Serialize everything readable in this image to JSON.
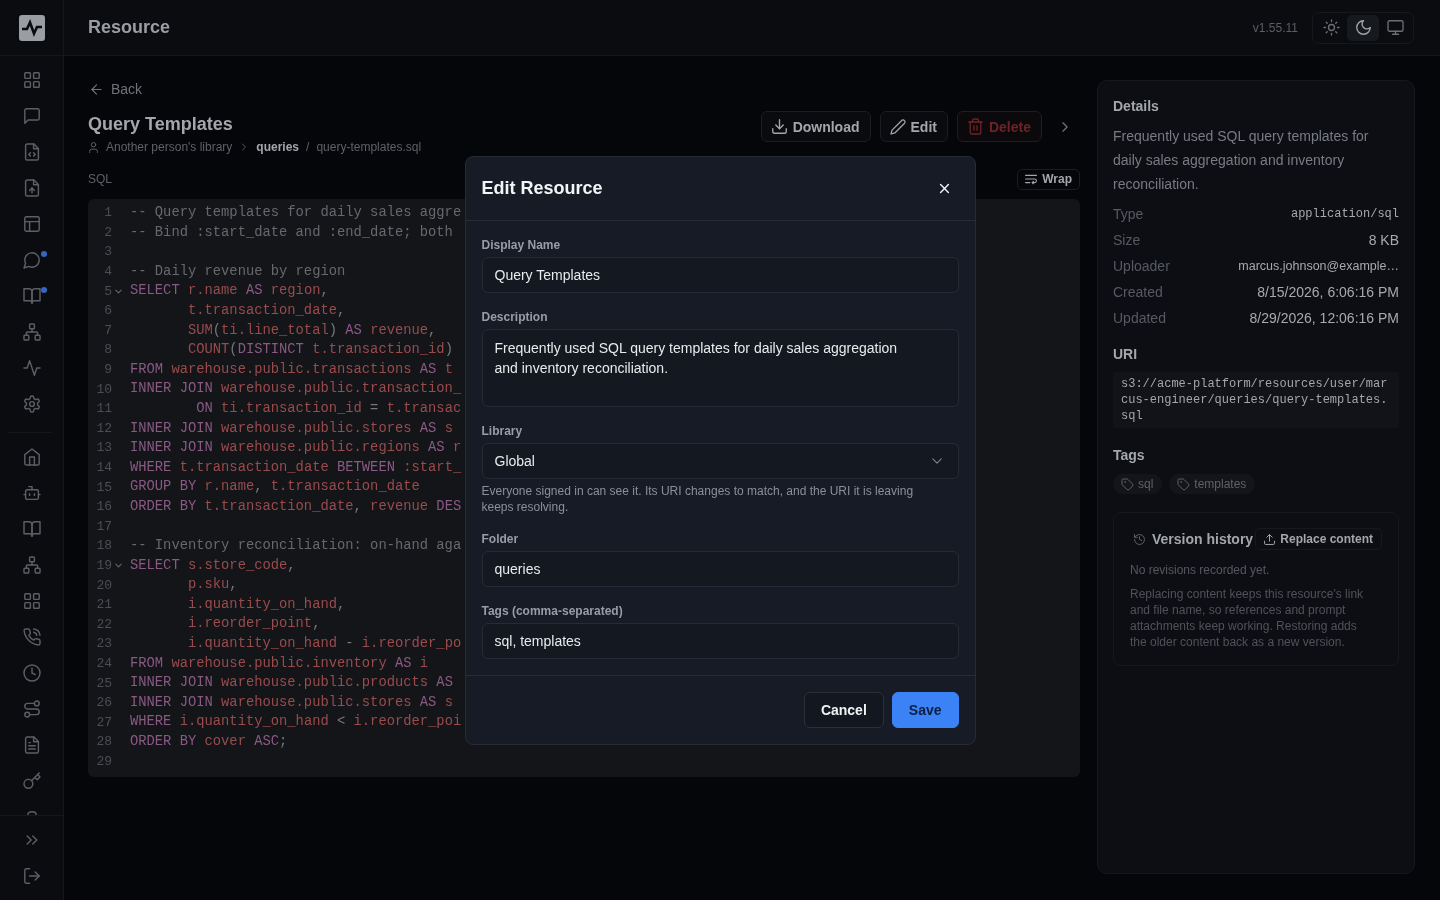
{
  "sidebar": {
    "primary_items": [
      {
        "badge": false
      },
      {
        "badge": false
      },
      {
        "badge": false
      },
      {
        "badge": false
      },
      {
        "badge": false
      },
      {
        "badge": true
      },
      {
        "badge": true
      },
      {
        "badge": false
      },
      {
        "badge": false
      },
      {
        "badge": false
      }
    ],
    "secondary_items": [
      {
        "badge": false
      },
      {
        "badge": false
      },
      {
        "badge": false
      },
      {
        "badge": false
      },
      {
        "badge": false
      },
      {
        "badge": false
      },
      {
        "badge": false
      },
      {
        "badge": false
      },
      {
        "badge": false
      },
      {
        "badge": false
      }
    ]
  },
  "header": {
    "title": "Resource",
    "version": "v1.55.11",
    "theme_options": [
      {
        "selected": false
      },
      {
        "selected": true
      },
      {
        "selected": false
      }
    ]
  },
  "page": {
    "back": "Back",
    "title": "Query Templates",
    "breadcrumb": {
      "owner": "Another person's library",
      "folder": "queries",
      "separator": "/",
      "file": "query-templates.sql"
    },
    "actions": [
      {
        "label": "Download",
        "kind": "download"
      },
      {
        "label": "Edit",
        "kind": "edit"
      },
      {
        "label": "Delete",
        "kind": "delete"
      }
    ]
  },
  "editor": {
    "language": "SQL",
    "wrap_button": "Wrap",
    "lines": [
      {
        "number": "1",
        "fold": false,
        "tokens": [
          {
            "kind": "comment",
            "text": "-- Query templates for daily sales aggre"
          }
        ]
      },
      {
        "number": "2",
        "fold": false,
        "tokens": [
          {
            "kind": "comment",
            "text": "-- Bind :start_date and :end_date; both"
          }
        ]
      },
      {
        "number": "3",
        "fold": false
      },
      {
        "number": "4",
        "fold": false,
        "tokens": [
          {
            "kind": "comment",
            "text": "-- Daily revenue by region"
          }
        ]
      },
      {
        "number": "5",
        "fold": true,
        "tokens": [
          {
            "kind": "keyword",
            "text": "SELECT "
          },
          {
            "kind": "name",
            "text": "r.name "
          },
          {
            "kind": "keyword",
            "text": "AS "
          },
          {
            "kind": "name",
            "text": "region"
          },
          {
            "kind": "punct",
            "text": ","
          }
        ]
      },
      {
        "number": "6",
        "fold": false,
        "tokens": [
          {
            "kind": "name",
            "text": "       t.transaction_date"
          },
          {
            "kind": "punct",
            "text": ","
          }
        ]
      },
      {
        "number": "7",
        "fold": false,
        "tokens": [
          {
            "kind": "name",
            "text": "       SUM"
          },
          {
            "kind": "punct",
            "text": "("
          },
          {
            "kind": "name",
            "text": "ti.line_total"
          },
          {
            "kind": "punct",
            "text": ") "
          },
          {
            "kind": "keyword",
            "text": "AS "
          },
          {
            "kind": "name",
            "text": "revenue"
          },
          {
            "kind": "punct",
            "text": ","
          }
        ]
      },
      {
        "number": "8",
        "fold": false,
        "tokens": [
          {
            "kind": "name",
            "text": "       COUNT"
          },
          {
            "kind": "punct",
            "text": "("
          },
          {
            "kind": "keyword",
            "text": "DISTINCT "
          },
          {
            "kind": "name",
            "text": "t.transaction_id"
          },
          {
            "kind": "punct",
            "text": ")"
          }
        ]
      },
      {
        "number": "9",
        "fold": false,
        "tokens": [
          {
            "kind": "keyword",
            "text": "FROM "
          },
          {
            "kind": "name",
            "text": "warehouse.public.transactions "
          },
          {
            "kind": "keyword",
            "text": "AS "
          },
          {
            "kind": "name",
            "text": "t"
          }
        ]
      },
      {
        "number": "10",
        "fold": false,
        "tokens": [
          {
            "kind": "keyword",
            "text": "INNER JOIN "
          },
          {
            "kind": "name",
            "text": "warehouse.public.transaction_"
          }
        ]
      },
      {
        "number": "11",
        "fold": false,
        "tokens": [
          {
            "kind": "keyword",
            "text": "        ON "
          },
          {
            "kind": "name",
            "text": "ti.transaction_id "
          },
          {
            "kind": "punct",
            "text": "= "
          },
          {
            "kind": "name",
            "text": "t.transac"
          }
        ]
      },
      {
        "number": "12",
        "fold": false,
        "tokens": [
          {
            "kind": "keyword",
            "text": "INNER JOIN "
          },
          {
            "kind": "name",
            "text": "warehouse.public.stores "
          },
          {
            "kind": "keyword",
            "text": "AS "
          },
          {
            "kind": "name",
            "text": "s"
          }
        ]
      },
      {
        "number": "13",
        "fold": false,
        "tokens": [
          {
            "kind": "keyword",
            "text": "INNER JOIN "
          },
          {
            "kind": "name",
            "text": "warehouse.public.regions "
          },
          {
            "kind": "keyword",
            "text": "AS "
          },
          {
            "kind": "name",
            "text": "r"
          }
        ]
      },
      {
        "number": "14",
        "fold": false,
        "tokens": [
          {
            "kind": "keyword",
            "text": "WHERE "
          },
          {
            "kind": "name",
            "text": "t.transaction_date "
          },
          {
            "kind": "keyword",
            "text": "BETWEEN "
          },
          {
            "kind": "name",
            "text": ":start_"
          }
        ]
      },
      {
        "number": "15",
        "fold": false,
        "tokens": [
          {
            "kind": "keyword",
            "text": "GROUP BY "
          },
          {
            "kind": "name",
            "text": "r.name"
          },
          {
            "kind": "punct",
            "text": ", "
          },
          {
            "kind": "name",
            "text": "t.transaction_date"
          }
        ]
      },
      {
        "number": "16",
        "fold": false,
        "tokens": [
          {
            "kind": "keyword",
            "text": "ORDER BY "
          },
          {
            "kind": "name",
            "text": "t.transaction_date"
          },
          {
            "kind": "punct",
            "text": ", "
          },
          {
            "kind": "name",
            "text": "revenue "
          },
          {
            "kind": "keyword",
            "text": "DES"
          }
        ]
      },
      {
        "number": "17",
        "fold": false
      },
      {
        "number": "18",
        "fold": false,
        "tokens": [
          {
            "kind": "comment",
            "text": "-- Inventory reconciliation: on-hand aga"
          }
        ]
      },
      {
        "number": "19",
        "fold": true,
        "tokens": [
          {
            "kind": "keyword",
            "text": "SELECT "
          },
          {
            "kind": "name",
            "text": "s.store_code"
          },
          {
            "kind": "punct",
            "text": ","
          }
        ]
      },
      {
        "number": "20",
        "fold": false,
        "tokens": [
          {
            "kind": "name",
            "text": "       p.sku"
          },
          {
            "kind": "punct",
            "text": ","
          }
        ]
      },
      {
        "number": "21",
        "fold": false,
        "tokens": [
          {
            "kind": "name",
            "text": "       i.quantity_on_hand"
          },
          {
            "kind": "punct",
            "text": ","
          }
        ]
      },
      {
        "number": "22",
        "fold": false,
        "tokens": [
          {
            "kind": "name",
            "text": "       i.reorder_point"
          },
          {
            "kind": "punct",
            "text": ","
          }
        ]
      },
      {
        "number": "23",
        "fold": false,
        "tokens": [
          {
            "kind": "name",
            "text": "       i.quantity_on_hand "
          },
          {
            "kind": "punct",
            "text": "- "
          },
          {
            "kind": "name",
            "text": "i.reorder_po"
          }
        ]
      },
      {
        "number": "24",
        "fold": false,
        "tokens": [
          {
            "kind": "keyword",
            "text": "FROM "
          },
          {
            "kind": "name",
            "text": "warehouse.public.inventory "
          },
          {
            "kind": "keyword",
            "text": "AS "
          },
          {
            "kind": "name",
            "text": "i"
          }
        ]
      },
      {
        "number": "25",
        "fold": false,
        "tokens": [
          {
            "kind": "keyword",
            "text": "INNER JOIN "
          },
          {
            "kind": "name",
            "text": "warehouse.public.products "
          },
          {
            "kind": "keyword",
            "text": "AS"
          }
        ]
      },
      {
        "number": "26",
        "fold": false,
        "tokens": [
          {
            "kind": "keyword",
            "text": "INNER JOIN "
          },
          {
            "kind": "name",
            "text": "warehouse.public.stores "
          },
          {
            "kind": "keyword",
            "text": "AS "
          },
          {
            "kind": "name",
            "text": "s"
          }
        ]
      },
      {
        "number": "27",
        "fold": false,
        "tokens": [
          {
            "kind": "keyword",
            "text": "WHERE "
          },
          {
            "kind": "name",
            "text": "i.quantity_on_hand "
          },
          {
            "kind": "punct",
            "text": "< "
          },
          {
            "kind": "name",
            "text": "i.reorder_poi"
          }
        ]
      },
      {
        "number": "28",
        "fold": false,
        "tokens": [
          {
            "kind": "keyword",
            "text": "ORDER BY "
          },
          {
            "kind": "name",
            "text": "cover "
          },
          {
            "kind": "keyword",
            "text": "ASC"
          },
          {
            "kind": "punct",
            "text": ";"
          }
        ]
      },
      {
        "number": "29",
        "fold": false
      }
    ]
  },
  "details": {
    "title": "Details",
    "description": "Frequently used SQL query templates for daily sales aggregation and inventory reconciliation.",
    "properties": [
      {
        "label": "Type",
        "value": "application/sql",
        "kind": "mono"
      },
      {
        "label": "Size",
        "value": "8 KB",
        "kind": "text"
      },
      {
        "label": "Uploader",
        "value": "marcus.johnson@example…",
        "kind": "small"
      },
      {
        "label": "Created",
        "value": "8/15/2026, 6:06:16 PM",
        "kind": "text"
      },
      {
        "label": "Updated",
        "value": "8/29/2026, 12:06:16 PM",
        "kind": "text"
      }
    ],
    "uri_title": "URI",
    "uri": "s3://acme-platform/resources/user/marcus-engineer/queries/query-templates.sql",
    "tags_title": "Tags",
    "tags": [
      "sql",
      "templates"
    ],
    "version_history": {
      "title": "Version history",
      "button": "Replace content",
      "empty": "No revisions recorded yet.",
      "note": "Replacing content keeps this resource's link and file name, so references and prompt attachments keep working. Restoring adds the older content back as a new version."
    }
  },
  "dialog": {
    "title": "Edit Resource",
    "fields": [
      {
        "label": "Display Name",
        "kind": "input",
        "value": "Query Templates"
      },
      {
        "label": "Description",
        "kind": "textarea",
        "value": "Frequently used SQL query templates for daily sales aggregation and inventory reconciliation."
      },
      {
        "label": "Library",
        "kind": "select",
        "value": "Global",
        "hint": "Everyone signed in can see it. Its URI changes to match, and the URI it is leaving keeps resolving."
      },
      {
        "label": "Folder",
        "kind": "input",
        "value": "queries"
      },
      {
        "label": "Tags (comma-separated)",
        "kind": "input",
        "value": "sql, templates"
      }
    ],
    "buttons": [
      {
        "label": "Cancel",
        "kind": "cancel"
      },
      {
        "label": "Save",
        "kind": "save"
      }
    ]
  }
}
